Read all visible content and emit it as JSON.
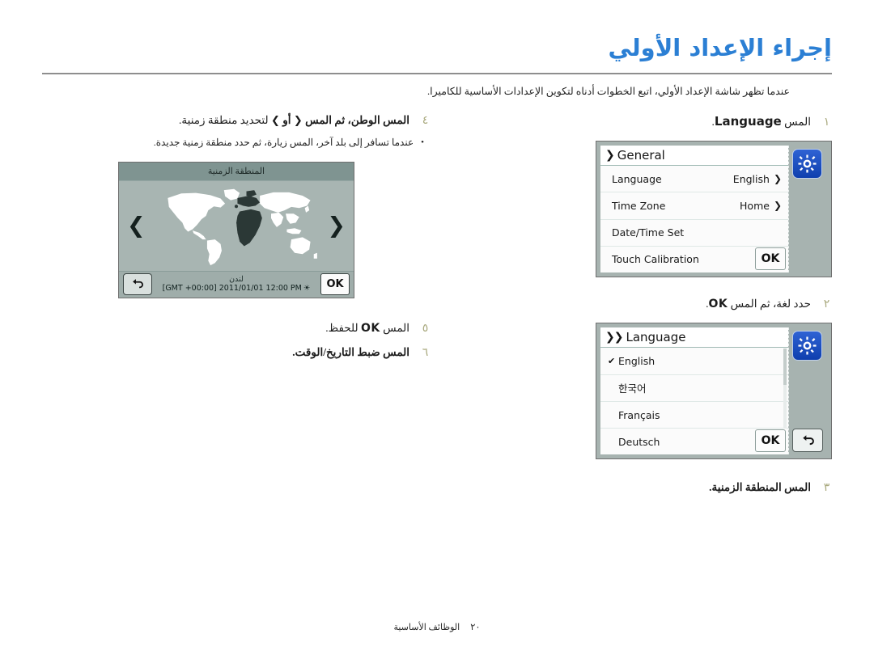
{
  "header": {
    "title": "إجراء الإعداد الأولي",
    "intro": "عندما تظهر شاشة الإعداد الأولي، اتبع الخطوات أدناه لتكوين الإعدادات الأساسية للكاميرا."
  },
  "right_column": {
    "step1": {
      "number": "١",
      "prefix": "المس",
      "keyword": "Language",
      "suffix": "."
    },
    "general_screen": {
      "icon": "gear-icon",
      "chevron": "❯",
      "title": "General",
      "rows": [
        {
          "label": "Language",
          "value": "English",
          "chevron": "❯"
        },
        {
          "label": "Time Zone",
          "value": "Home",
          "chevron": "❯"
        },
        {
          "label": "Date/Time Set",
          "value": "",
          "chevron": ""
        },
        {
          "label": "Touch Calibration",
          "value": "",
          "chevron": ""
        }
      ],
      "ok_label": "OK"
    },
    "step2": {
      "number": "٢",
      "prefix": "حدد لغة، ثم المس",
      "keyword": "OK",
      "suffix": "."
    },
    "language_screen": {
      "icon": "gear-icon",
      "chevron": "❯❯",
      "title": "Language",
      "items": [
        {
          "label": "English",
          "checked": "✔"
        },
        {
          "label": "한국어",
          "checked": ""
        },
        {
          "label": "Français",
          "checked": ""
        },
        {
          "label": "Deutsch",
          "checked": ""
        }
      ],
      "ok_label": "OK",
      "back_label": "back-arrow"
    },
    "step3": {
      "number": "٣",
      "text": "المس المنطقة الزمنية."
    }
  },
  "left_column": {
    "step4": {
      "number": "٤",
      "part1": "المس الوطن، ثم المس",
      "arrow_left": "❮",
      "or": "أو",
      "arrow_right": "❯",
      "part2": "لتحديد منطقة زمنية.",
      "bullet_dot": "•",
      "bullet": "عندما تسافر إلى بلد آخر، المس زيارة، ثم حدد منطقة زمنية جديدة."
    },
    "map_screen": {
      "header_title": "المنطقة الزمنية",
      "arrow_left": "❮",
      "arrow_right": "❯",
      "city": "لندن",
      "datetime": "[GMT +00:00] 2011/01/01 12:00 PM",
      "sun_icon": "☀",
      "ok_label": "OK",
      "back_label": "back-arrow"
    },
    "step5": {
      "number": "٥",
      "prefix": "المس",
      "keyword": "OK",
      "suffix": "للحفظ."
    },
    "step6": {
      "number": "٦",
      "text": "المس ضبط التاريخ/الوقت."
    }
  },
  "footer": {
    "section": "الوظائف الأساسية",
    "page": "٢٠"
  },
  "colors": {
    "title_blue": "#2b7fd4",
    "step_number": "#a9a97e",
    "screen_bg": "#a7b3b0",
    "map_header": "#7f9491",
    "gear_blue": "#1a49bb"
  }
}
